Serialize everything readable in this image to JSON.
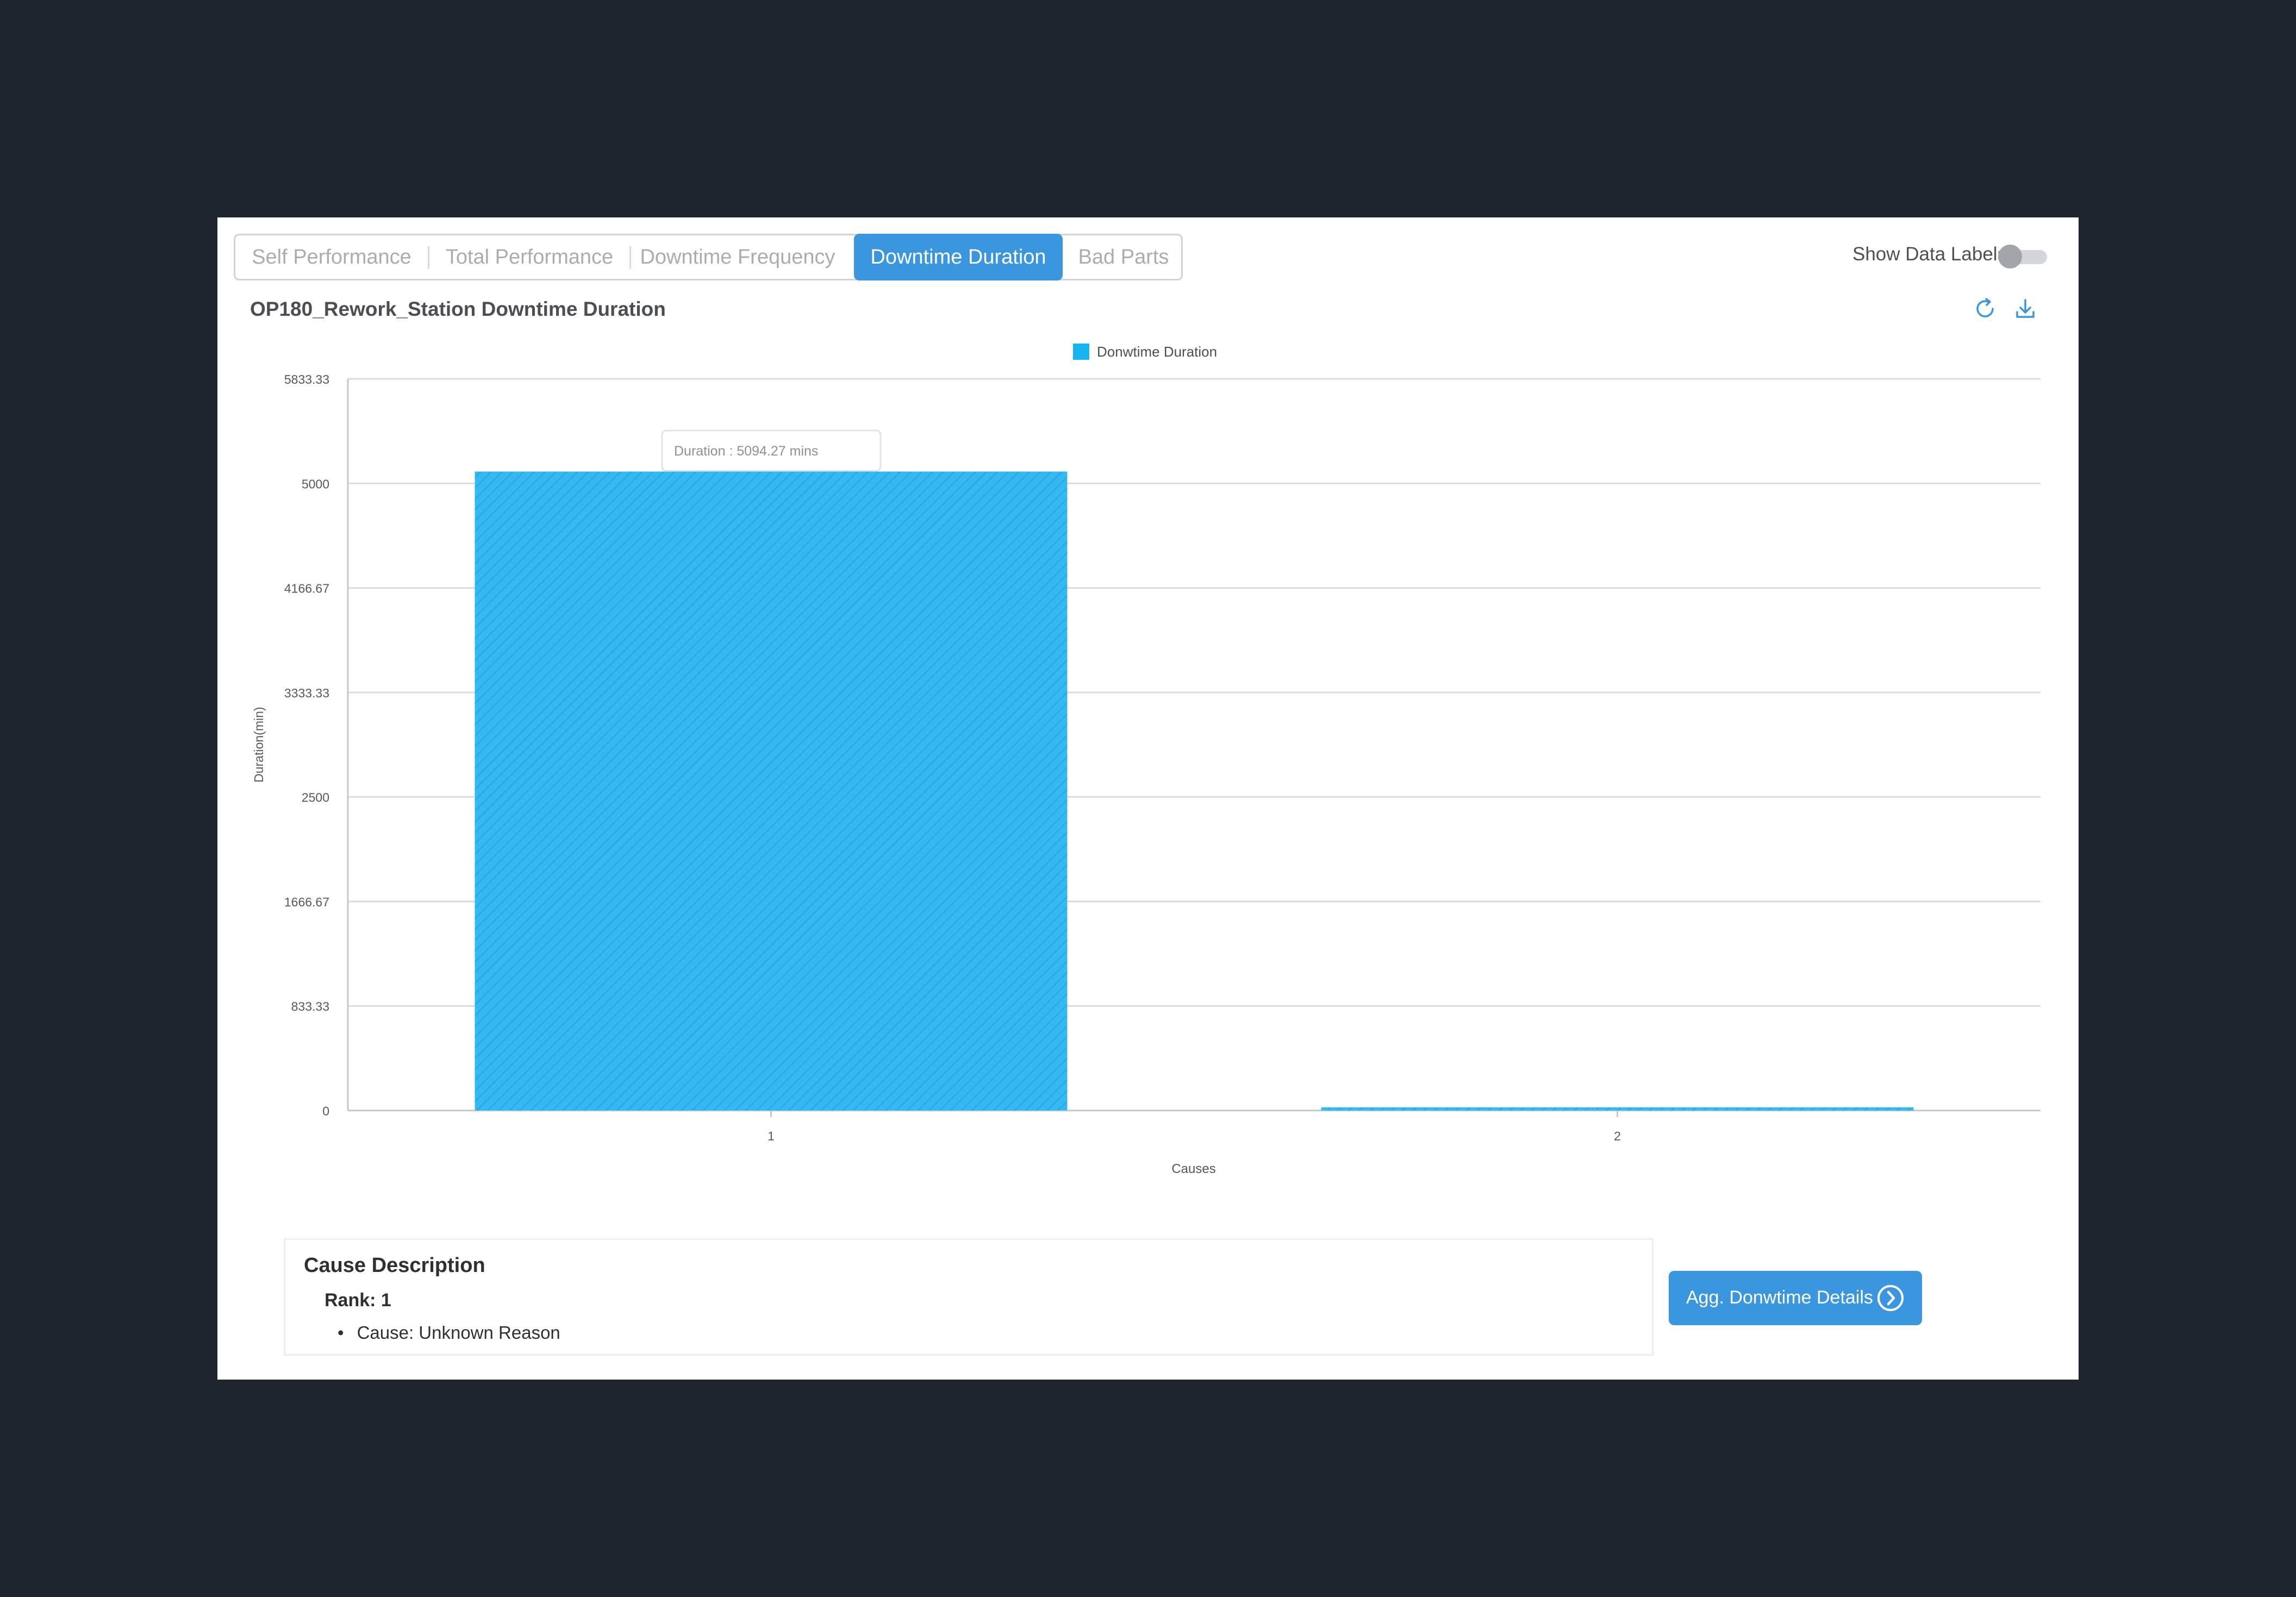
{
  "tabs": [
    {
      "label": "Self Performance",
      "active": false
    },
    {
      "label": "Total Performance",
      "active": false
    },
    {
      "label": "Downtime Frequency",
      "active": false
    },
    {
      "label": "Downtime Duration",
      "active": true
    },
    {
      "label": "Bad Parts",
      "active": false
    }
  ],
  "toggle": {
    "label": "Show Data Labels",
    "on": false
  },
  "chart_header": {
    "title": "OP180_Rework_Station Downtime Duration"
  },
  "icons": {
    "refresh": "refresh-icon",
    "download": "download-icon"
  },
  "colors": {
    "accent": "#3a97df",
    "bar": "#34b9f2",
    "legend": "#16b4f0"
  },
  "chart_data": {
    "type": "bar",
    "categories": [
      "1",
      "2"
    ],
    "series": [
      {
        "name": "Donwtime Duration",
        "values": [
          5094.27,
          25
        ]
      }
    ],
    "xlabel": "Causes",
    "ylabel": "Duration(min)",
    "ylim": [
      0,
      5833.33
    ],
    "yticks": [
      "0",
      "833.33",
      "1666.67",
      "2500",
      "3333.33",
      "4166.67",
      "5000",
      "5833.33"
    ],
    "grid": true,
    "legend_position": "top-center",
    "tooltip": {
      "text": "Duration : 5094.27 mins",
      "category": "1"
    }
  },
  "cause": {
    "title": "Cause Description",
    "rank": "Rank: 1",
    "items": [
      "Cause: Unknown Reason"
    ]
  },
  "agg_button": {
    "label": "Agg. Donwtime Details"
  }
}
